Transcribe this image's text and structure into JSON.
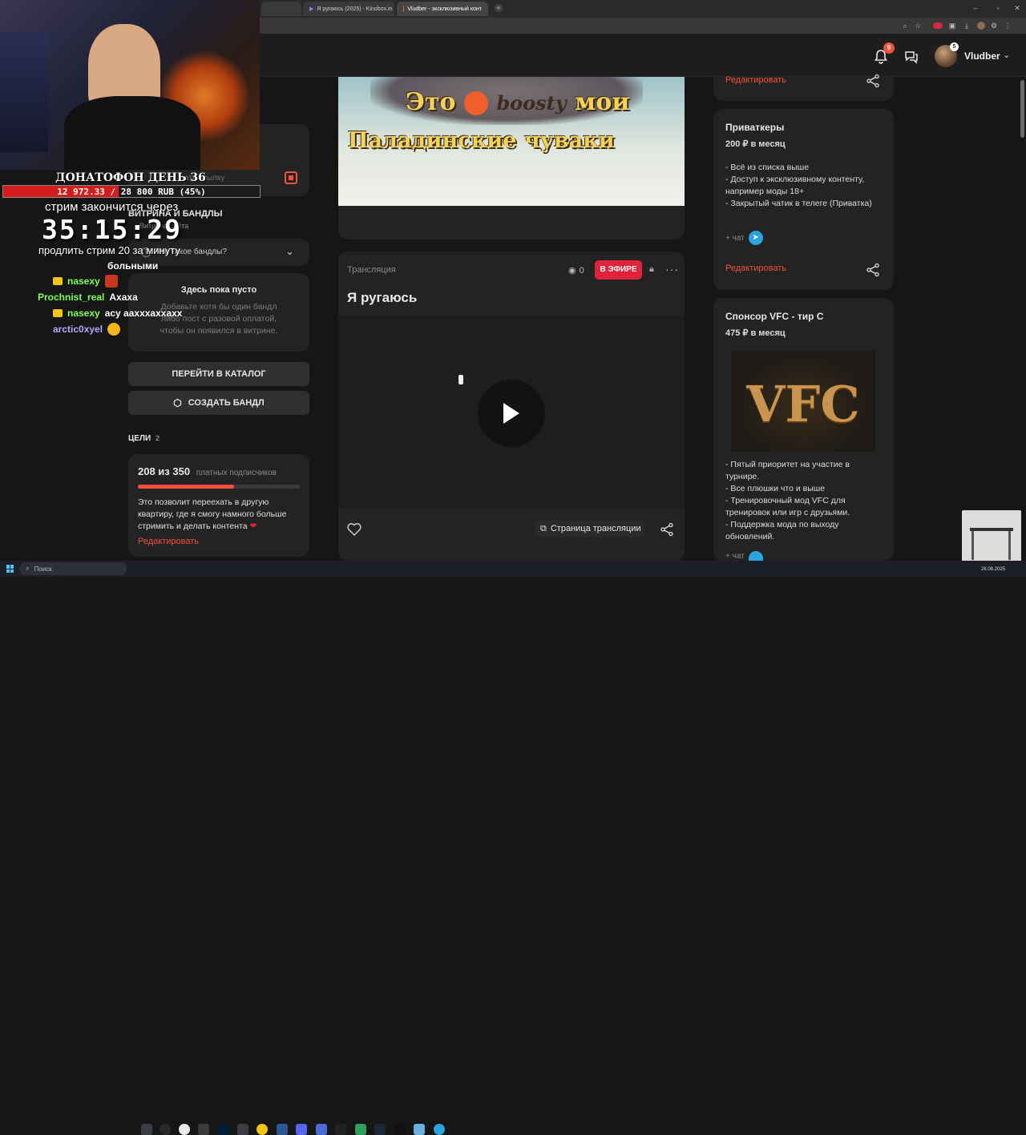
{
  "browser": {
    "tabs": [
      {
        "label": "Я ругаюсь (2025) - Kinobox.in"
      },
      {
        "label": "Vludber - эксклюзивный конт"
      }
    ]
  },
  "header": {
    "notifications_badge": "9",
    "messages_badge": "5",
    "username": "Vludber"
  },
  "left": {
    "link_text": "ать ссылку",
    "showcase_title": "ВИТРИНА И БАНДЛЫ",
    "showcase_sub": "Витрина сайта",
    "bundles_question": "Что такое бандлы?",
    "empty_title": "Здесь пока пусто",
    "empty_text": "Добавьте хотя бы один бандл либо пост с разовой оплатой, чтобы он появился в витрине.",
    "catalog_button": "ПЕРЕЙТИ В КАТАЛОГ",
    "bundle_button": "СОЗДАТЬ БАНДЛ",
    "goals_title": "ЦЕЛИ",
    "goals_count": "2",
    "goal_progress": "208 из 350",
    "goal_unit": "платных подписчиков",
    "goal_fill": 0.594,
    "goal_text": "Это позволит переехать в другую квартиру, где я смогу намного больше стримить и делать контента",
    "goal_edit": "Редактировать"
  },
  "post_image": {
    "line1_a": "Это",
    "line1_brand": "boosty",
    "line1_b": "мои",
    "line2": "Паладинские чуваки"
  },
  "stream_post": {
    "type_label": "Трансляция",
    "views": "0",
    "live_badge": "В ЭФИРЕ",
    "title": "Я ругаюсь",
    "stream_page_button": "Страница трансляции"
  },
  "right": {
    "top_edit": "Редактировать",
    "tier1": {
      "name": "Приваткеры",
      "price": "200 ₽ в месяц",
      "desc": [
        "- Всё из списка выше",
        "- Доступ к эксклюзивному контенту, например моды 18+",
        "- Закрытый чатик в телеге (Приватка)"
      ],
      "chat": "+ чат",
      "edit": "Редактировать"
    },
    "tier2": {
      "name": "Спонсор VFC - тир C",
      "price": "475 ₽ в месяц",
      "logo_text": "VFC",
      "desc": [
        "- Пятый приоритет на участие в турнире.",
        "- Все плюшки что и выше",
        "- Тренировочный мод VFC для тренировок или игр с друзьями.",
        "- Поддержка мода по выходу обновлений."
      ],
      "chat": "+ чат"
    }
  },
  "overlay": {
    "donation_title": "ДОНАТОФОН ДЕНЬ 36",
    "donation_progress": "12 972.33 / 28 800 RUB (45%)",
    "donation_fill": 0.45,
    "timer_label": "стрим закончится через",
    "timer": "35:15:29",
    "extend_text": "продлить стрим 20 за минуту",
    "chat": [
      {
        "user": "",
        "text": "больными",
        "color": "#ffffff"
      },
      {
        "user": "nasexy",
        "text": "",
        "color": "#7dff5a"
      },
      {
        "user": "Prochnist_real",
        "text": "Ахаха",
        "color": "#7dff5a"
      },
      {
        "user": "nasexy",
        "text": "асу аахххаххахх",
        "color": "#7dff5a"
      },
      {
        "user": "arctic0xyel",
        "text": "",
        "color": "#b9a4ff"
      }
    ]
  },
  "taskbar": {
    "search_placeholder": "Поиск",
    "date": "26.08.2025"
  }
}
